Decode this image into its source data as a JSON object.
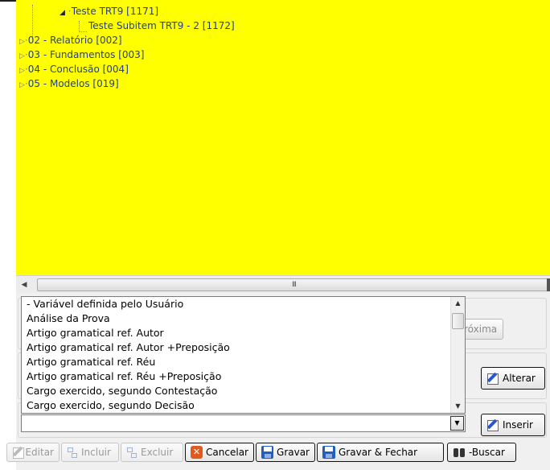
{
  "tree": {
    "nodes": [
      {
        "label": "Teste TRT9 [1171]",
        "expanded": true
      },
      {
        "label": "Teste Subitem TRT9 - 2 [1172]"
      },
      {
        "label": "02 - Relatório [002]"
      },
      {
        "label": "03 - Fundamentos [003]"
      },
      {
        "label": "04 - Conclusão [004]"
      },
      {
        "label": "05 - Modelos [019]"
      }
    ],
    "background": "#ffff00"
  },
  "hscroll": {
    "grip": "III"
  },
  "dropdown": {
    "items": [
      " - Variável definida pelo Usuário",
      "Análise da Prova",
      "Artigo gramatical ref. Autor",
      "Artigo gramatical ref. Autor +Preposição",
      "Artigo gramatical ref. Réu",
      "Artigo gramatical ref. Réu +Preposição",
      "Cargo exercido, segundo Contestação",
      "Cargo exercido, segundo Decisão"
    ],
    "value": ""
  },
  "buttons": {
    "proxima": "róxima",
    "alterar": "Alterar",
    "inserir": "Inserir"
  },
  "toolbar": {
    "editar": "Editar",
    "incluir": "Incluir",
    "excluir": "Excluir",
    "cancelar": "Cancelar",
    "gravar": "Gravar",
    "gravar_fechar": "Gravar & Fechar",
    "buscar": "-Buscar"
  }
}
